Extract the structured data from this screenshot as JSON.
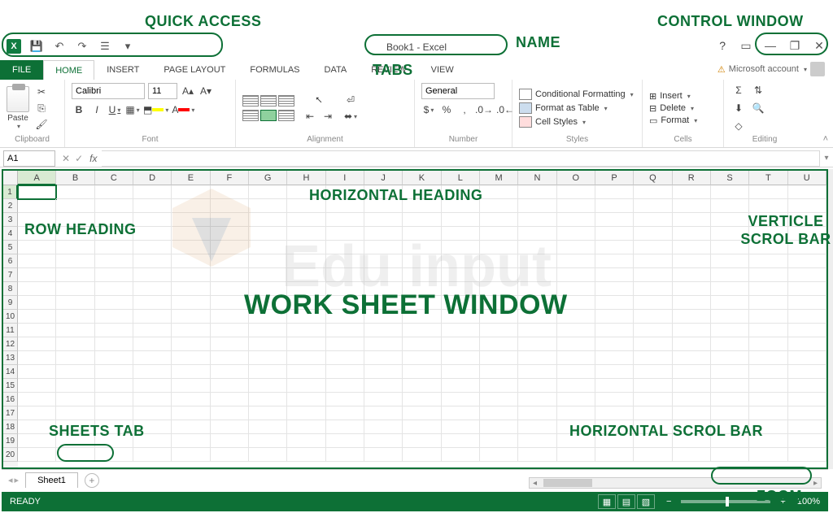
{
  "annotations": {
    "quick_access": "QUICK ACCESS",
    "name": "NAME",
    "control_window": "CONTROL WINDOW",
    "tabs": "TABS",
    "horizontal_heading": "HORIZONTAL HEADING",
    "row_heading": "ROW HEADING",
    "verticle_scroll": "VERTICLE SCROL BAR",
    "worksheet_window": "WORK SHEET WINDOW",
    "sheets_tab": "SHEETS TAB",
    "horizontal_scroll": "HORIZONTAL SCROL BAR",
    "zoom": "ZOOM"
  },
  "titlebar": {
    "app_title": "Book1 - Excel",
    "help": "?",
    "ribbon_opts_icon": "▭",
    "minimize": "—",
    "restore": "❐",
    "close": "✕"
  },
  "quick_access": {
    "excel": "X",
    "save_icon": "💾",
    "undo_icon": "↶",
    "redo_icon": "↷",
    "touch_icon": "☰",
    "customize": "▾"
  },
  "ribbon_tabs": {
    "file": "FILE",
    "home": "HOME",
    "insert": "INSERT",
    "page_layout": "PAGE LAYOUT",
    "formulas": "FORMULAS",
    "data": "DATA",
    "review": "REVIEW",
    "view": "VIEW"
  },
  "account": {
    "warn": "⚠",
    "label": "Microsoft account",
    "caret": "▾"
  },
  "ribbon": {
    "clipboard": {
      "label": "Clipboard",
      "paste": "Paste",
      "cut": "✂",
      "copy": "⎘",
      "painter": "🖌"
    },
    "font": {
      "label": "Font",
      "name": "Calibri",
      "size": "11",
      "grow": "A▴",
      "shrink": "A▾",
      "bold": "B",
      "italic": "I",
      "underline": "U",
      "border": "▦",
      "fill": "⬒",
      "color": "A",
      "fill_color": "#ffff00",
      "font_color": "#ff0000"
    },
    "alignment": {
      "label": "Alignment",
      "wrap": "Wrap Text",
      "merge": "Merge & Center",
      "indent_dec": "⇤",
      "indent_inc": "⇥",
      "orient": "⭦"
    },
    "number": {
      "label": "Number",
      "format": "General",
      "currency": "$",
      "percent": "%",
      "comma": ",",
      "inc_dec": "⁺₀₀",
      "dec_dec": "⁻₀₀"
    },
    "styles": {
      "label": "Styles",
      "cond": "Conditional Formatting",
      "table": "Format as Table",
      "cell": "Cell Styles"
    },
    "cells": {
      "label": "Cells",
      "insert": "Insert",
      "delete": "Delete",
      "format": "Format"
    },
    "editing": {
      "label": "Editing",
      "sum": "Σ",
      "fill": "⬇",
      "clear": "◇",
      "sort": "⇅",
      "find": "🔍"
    }
  },
  "formula_bar": {
    "cell_ref": "A1",
    "cancel": "✕",
    "enter": "✓",
    "fx": "fx",
    "formula": ""
  },
  "grid": {
    "columns": [
      "A",
      "B",
      "C",
      "D",
      "E",
      "F",
      "G",
      "H",
      "I",
      "J",
      "K",
      "L",
      "M",
      "N",
      "O",
      "P",
      "Q",
      "R",
      "S",
      "T",
      "U"
    ],
    "rows": [
      "1",
      "2",
      "3",
      "4",
      "5",
      "6",
      "7",
      "8",
      "9",
      "10",
      "11",
      "12",
      "13",
      "14",
      "15",
      "16",
      "17",
      "18",
      "19",
      "20"
    ],
    "active_col": 0,
    "active_row": 0
  },
  "sheets": {
    "nav_prev": "◂",
    "nav_next": "▸",
    "sheet1": "Sheet1",
    "add": "+"
  },
  "status": {
    "ready": "READY",
    "view_normal": "▦",
    "view_layout": "▤",
    "view_break": "▧",
    "zoom_minus": "−",
    "zoom_plus": "+",
    "zoom_pct": "100%"
  },
  "watermark": {
    "text": "Edu input",
    "sub": ""
  }
}
